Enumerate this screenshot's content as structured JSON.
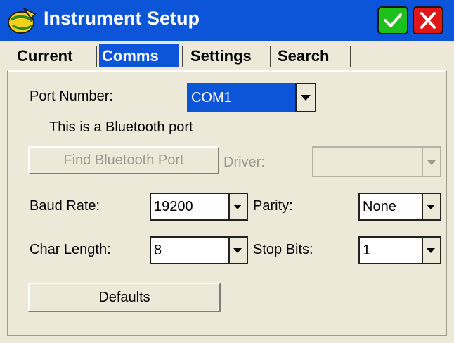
{
  "window": {
    "title": "Instrument Setup"
  },
  "tabs": [
    {
      "label": "Current"
    },
    {
      "label": "Comms",
      "active": true
    },
    {
      "label": "Settings"
    },
    {
      "label": "Search"
    }
  ],
  "comms": {
    "port_number": {
      "label": "Port Number:",
      "value": "COM1"
    },
    "bluetooth_checkbox": {
      "label": "This is a Bluetooth port",
      "checked": false
    },
    "find_bluetooth_button": {
      "label": "Find Bluetooth Port",
      "enabled": false
    },
    "driver": {
      "label": "Driver:",
      "value": "",
      "enabled": false
    },
    "baud_rate": {
      "label": "Baud Rate:",
      "value": "19200"
    },
    "parity": {
      "label": "Parity:",
      "value": "None"
    },
    "char_length": {
      "label": "Char Length:",
      "value": "8"
    },
    "stop_bits": {
      "label": "Stop Bits:",
      "value": "1"
    },
    "defaults_button": {
      "label": "Defaults"
    }
  },
  "icons": {
    "app": "instrument-setup-icon",
    "ok": "check-icon",
    "close": "close-icon",
    "dropdown": "chevron-down-icon"
  },
  "colors": {
    "titlebar": "#0c55d8",
    "active_tab": "#0c55d8",
    "selected_value": "#0c55d8",
    "panel": "#ece9d8",
    "ok_button": "#1cc11c",
    "close_button": "#e01717",
    "disabled_text": "#9d9b90"
  }
}
